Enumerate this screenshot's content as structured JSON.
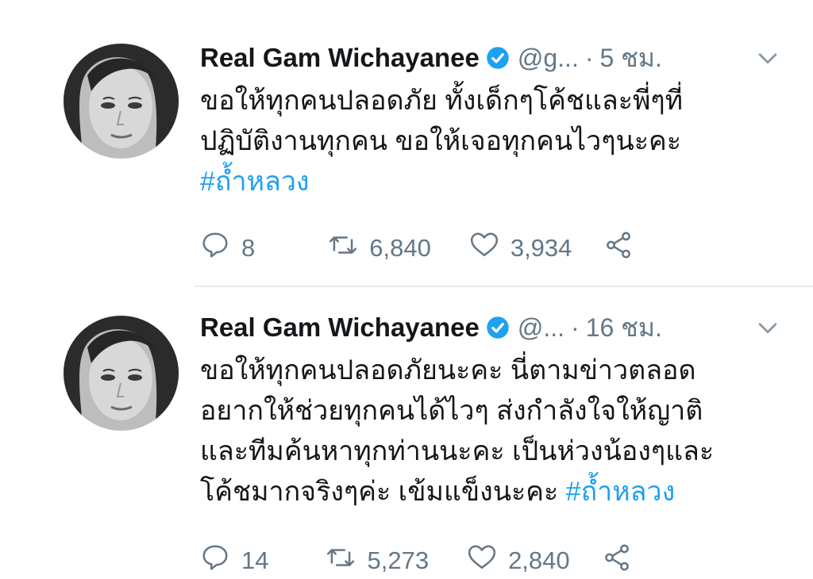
{
  "tweets": [
    {
      "name": "Real Gam Wichayanee",
      "handle": "@g...",
      "separator": "·",
      "time": "5 ชม.",
      "text_lines": [
        "ขอให้ทุกคนปลอดภัย ทั้งเด็กๆโค้ชและพี่ๆที่",
        "ปฏิบัติงานทุกคน ขอให้เจอทุกคนไวๆนะคะ"
      ],
      "hashtag": "#ถ้ำหลวง",
      "replies": "8",
      "retweets": "6,840",
      "likes": "3,934"
    },
    {
      "name": "Real Gam Wichayanee",
      "handle": "@...",
      "separator": "·",
      "time": "16 ชม.",
      "text_lines": [
        "ขอให้ทุกคนปลอดภัยนะคะ นี่ตามข่าวตลอด",
        "อยากให้ช่วยทุกคนได้ไวๆ ส่งกำลังใจให้ญาติ",
        "และทีมค้นหาทุกท่านนะคะ เป็นห่วงน้องๆและ",
        "โค้ชมากจริงๆค่ะ เข้มแข็งนะคะ "
      ],
      "hashtag": "#ถ้ำหลวง",
      "replies": "14",
      "retweets": "5,273",
      "likes": "2,840"
    }
  ],
  "colors": {
    "accent": "#1da1f2",
    "secondary_text": "#657786",
    "primary_text": "#14171a",
    "divider": "#e6ecf0"
  },
  "icons": [
    "verified-badge-icon",
    "chevron-down-icon",
    "reply-icon",
    "retweet-icon",
    "like-icon",
    "share-icon"
  ]
}
